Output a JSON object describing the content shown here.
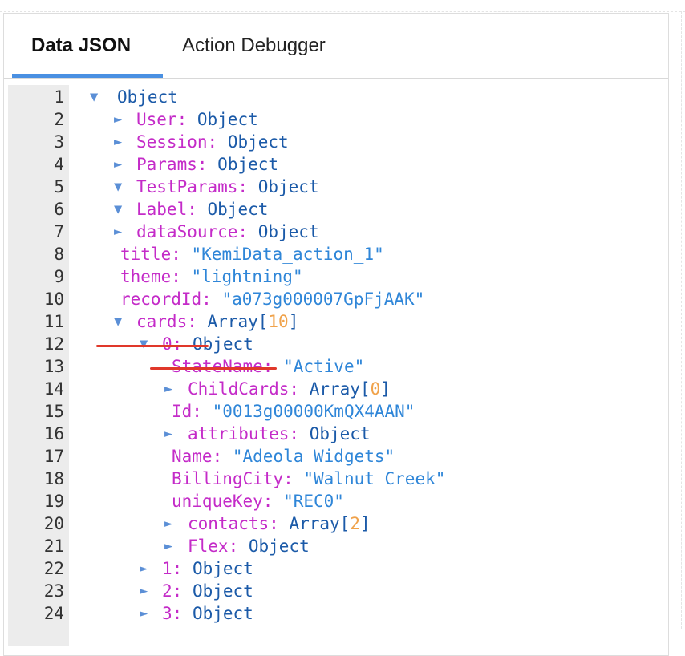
{
  "tabs": [
    {
      "label": "Data JSON",
      "active": true
    },
    {
      "label": "Action Debugger",
      "active": false
    }
  ],
  "colors": {
    "accent": "#4a90e2",
    "key": "#c42bc8",
    "type": "#1b5aa8",
    "string": "#2f86d8",
    "number": "#f0a24a",
    "annotation": "#e0382a"
  },
  "lines": [
    {
      "n": "1",
      "toggle": "▼",
      "type": "Object"
    },
    {
      "n": "2",
      "toggle": "►",
      "key": "User:",
      "type": "Object"
    },
    {
      "n": "3",
      "toggle": "►",
      "key": "Session:",
      "type": "Object"
    },
    {
      "n": "4",
      "toggle": "►",
      "key": "Params:",
      "type": "Object"
    },
    {
      "n": "5",
      "toggle": "▼",
      "key": "TestParams:",
      "type": "Object"
    },
    {
      "n": "6",
      "toggle": "▼",
      "key": "Label:",
      "type": "Object"
    },
    {
      "n": "7",
      "toggle": "►",
      "key": "dataSource:",
      "type": "Object"
    },
    {
      "n": "8",
      "key": "title:",
      "str": "\"KemiData_action_1\""
    },
    {
      "n": "9",
      "key": "theme:",
      "str": "\"lightning\""
    },
    {
      "n": "10",
      "key": "recordId:",
      "str": "\"a073g000007GpFjAAK\""
    },
    {
      "n": "11",
      "toggle": "▼",
      "key": "cards:",
      "type": "Array",
      "count": "10"
    },
    {
      "n": "12",
      "toggle": "▼",
      "key": "0:",
      "type": "Object"
    },
    {
      "n": "13",
      "key": "StateName:",
      "str": "\"Active\""
    },
    {
      "n": "14",
      "toggle": "►",
      "key": "ChildCards:",
      "type": "Array",
      "count": "0"
    },
    {
      "n": "15",
      "key": "Id:",
      "str": "\"0013g00000KmQX4AAN\""
    },
    {
      "n": "16",
      "toggle": "►",
      "key": "attributes:",
      "type": "Object"
    },
    {
      "n": "17",
      "key": "Name:",
      "str": "\"Adeola Widgets\""
    },
    {
      "n": "18",
      "key": "BillingCity:",
      "str": "\"Walnut Creek\""
    },
    {
      "n": "19",
      "key": "uniqueKey:",
      "str": "\"REC0\""
    },
    {
      "n": "20",
      "toggle": "►",
      "key": "contacts:",
      "type": "Array",
      "count": "2"
    },
    {
      "n": "21",
      "toggle": "►",
      "key": "Flex:",
      "type": "Object"
    },
    {
      "n": "22",
      "toggle": "►",
      "key": "1:",
      "type": "Object"
    },
    {
      "n": "23",
      "toggle": "►",
      "key": "2:",
      "type": "Object"
    },
    {
      "n": "24",
      "toggle": "►",
      "key": "3:",
      "type": "Object"
    }
  ]
}
